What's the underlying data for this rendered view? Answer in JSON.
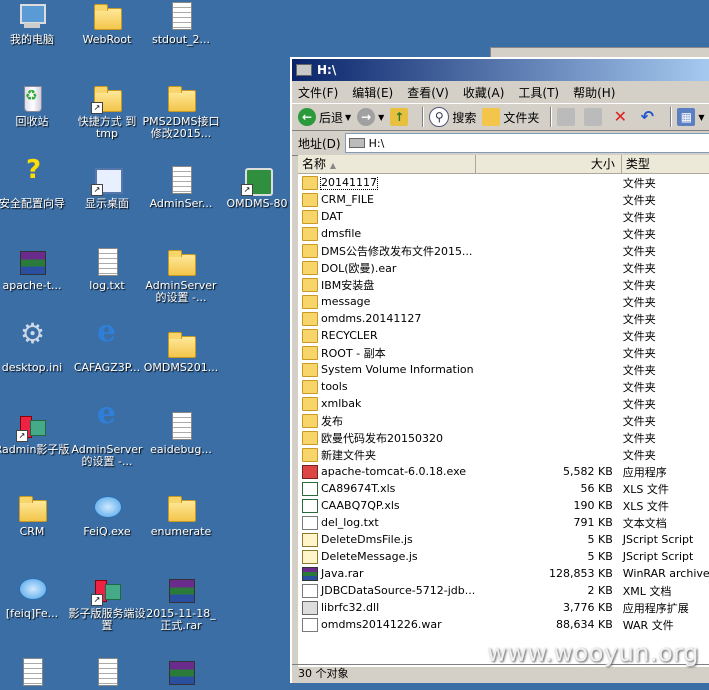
{
  "desktop": {
    "icons": [
      {
        "label": "我的电脑",
        "icon": "computer-icon"
      },
      {
        "label": "WebRoot",
        "icon": "folder-icon"
      },
      {
        "label": "stdout_2...",
        "icon": "text-file-icon"
      },
      {
        "label": "回收站",
        "icon": "recycle-bin-icon"
      },
      {
        "label": "快捷方式 到 tmp",
        "icon": "folder-shortcut-icon"
      },
      {
        "label": "PMS2DMS接口修改2015...",
        "icon": "folder-icon"
      },
      {
        "label": "安全配置向导",
        "icon": "security-wizard-icon"
      },
      {
        "label": "显示桌面",
        "icon": "show-desktop-icon"
      },
      {
        "label": "AdminSer...",
        "icon": "text-file-icon"
      },
      {
        "label": "OMDMS-80",
        "icon": "app-shortcut-icon"
      },
      {
        "label": "apache-t...",
        "icon": "winrar-archive-icon"
      },
      {
        "label": "log.txt",
        "icon": "text-file-icon"
      },
      {
        "label": "AdminServer 的设置 -...",
        "icon": "folder-icon"
      },
      {
        "label": "desktop.ini",
        "icon": "settings-file-icon"
      },
      {
        "label": "CAFAGZ3P...",
        "icon": "ie-icon"
      },
      {
        "label": "OMDMS201...",
        "icon": "folder-icon"
      },
      {
        "label": "Radmin影子版",
        "icon": "radmin-icon"
      },
      {
        "label": "AdminServer 的设置 -...",
        "icon": "ie-icon"
      },
      {
        "label": "eaidebug...",
        "icon": "text-file-icon"
      },
      {
        "label": "CRM",
        "icon": "folder-icon"
      },
      {
        "label": "FeiQ.exe",
        "icon": "feiq-icon"
      },
      {
        "label": "enumerate",
        "icon": "folder-icon"
      },
      {
        "label": "[feiq]Fe...",
        "icon": "feiq-icon"
      },
      {
        "label": "影子版服务端设置",
        "icon": "radmin-icon"
      },
      {
        "label": "2015-11-18_正式.rar",
        "icon": "winrar-archive-icon"
      }
    ]
  },
  "window": {
    "title": "H:\\",
    "menu": [
      "文件(F)",
      "编辑(E)",
      "查看(V)",
      "收藏(A)",
      "工具(T)",
      "帮助(H)"
    ],
    "toolbar": {
      "back": "后退",
      "search": "搜索",
      "folders": "文件夹"
    },
    "address_label": "地址(D)",
    "address_value": "H:\\",
    "columns": {
      "name": "名称",
      "size": "大小",
      "type": "类型"
    },
    "files": [
      {
        "name": "20141117",
        "size": "",
        "type": "文件夹",
        "kind": "folder"
      },
      {
        "name": "CRM_FILE",
        "size": "",
        "type": "文件夹",
        "kind": "folder"
      },
      {
        "name": "DAT",
        "size": "",
        "type": "文件夹",
        "kind": "folder"
      },
      {
        "name": "dmsfile",
        "size": "",
        "type": "文件夹",
        "kind": "folder"
      },
      {
        "name": "DMS公告修改发布文件2015...",
        "size": "",
        "type": "文件夹",
        "kind": "folder"
      },
      {
        "name": "DOL(欧曼).ear",
        "size": "",
        "type": "文件夹",
        "kind": "folder"
      },
      {
        "name": "IBM安装盘",
        "size": "",
        "type": "文件夹",
        "kind": "folder"
      },
      {
        "name": "message",
        "size": "",
        "type": "文件夹",
        "kind": "folder"
      },
      {
        "name": "omdms.20141127",
        "size": "",
        "type": "文件夹",
        "kind": "folder"
      },
      {
        "name": "RECYCLER",
        "size": "",
        "type": "文件夹",
        "kind": "folder"
      },
      {
        "name": "ROOT - 副本",
        "size": "",
        "type": "文件夹",
        "kind": "folder"
      },
      {
        "name": "System Volume Information",
        "size": "",
        "type": "文件夹",
        "kind": "folder"
      },
      {
        "name": "tools",
        "size": "",
        "type": "文件夹",
        "kind": "folder"
      },
      {
        "name": "xmlbak",
        "size": "",
        "type": "文件夹",
        "kind": "folder"
      },
      {
        "name": "发布",
        "size": "",
        "type": "文件夹",
        "kind": "folder"
      },
      {
        "name": "欧曼代码发布20150320",
        "size": "",
        "type": "文件夹",
        "kind": "folder"
      },
      {
        "name": "新建文件夹",
        "size": "",
        "type": "文件夹",
        "kind": "folder"
      },
      {
        "name": "apache-tomcat-6.0.18.exe",
        "size": "5,582 KB",
        "type": "应用程序",
        "kind": "exe"
      },
      {
        "name": "CA89674T.xls",
        "size": "56 KB",
        "type": "XLS 文件",
        "kind": "xls"
      },
      {
        "name": "CAABQ7QP.xls",
        "size": "190 KB",
        "type": "XLS 文件",
        "kind": "xls"
      },
      {
        "name": "del_log.txt",
        "size": "791 KB",
        "type": "文本文档",
        "kind": "file"
      },
      {
        "name": "DeleteDmsFile.js",
        "size": "5 KB",
        "type": "JScript Script",
        "kind": "js"
      },
      {
        "name": "DeleteMessage.js",
        "size": "5 KB",
        "type": "JScript Script",
        "kind": "js"
      },
      {
        "name": "Java.rar",
        "size": "128,853 KB",
        "type": "WinRAR archive",
        "kind": "rar"
      },
      {
        "name": "JDBCDataSource-5712-jdb...",
        "size": "2 KB",
        "type": "XML 文档",
        "kind": "file"
      },
      {
        "name": "librfc32.dll",
        "size": "3,776 KB",
        "type": "应用程序扩展",
        "kind": "dll"
      },
      {
        "name": "omdms20141226.war",
        "size": "88,634 KB",
        "type": "WAR 文件",
        "kind": "file"
      }
    ],
    "status": "30 个对象"
  },
  "watermark": "www.wooyun.org"
}
